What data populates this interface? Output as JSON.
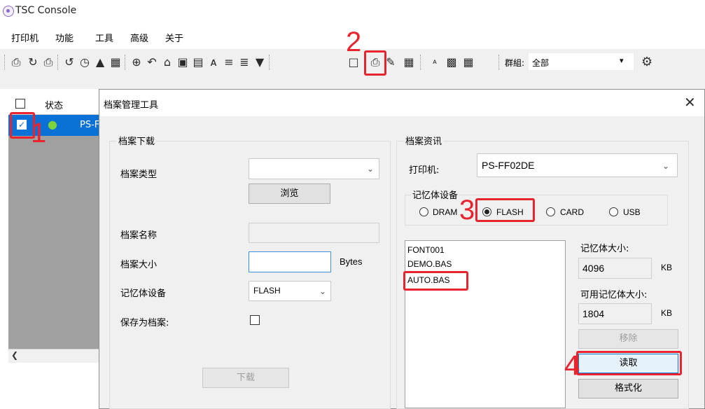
{
  "window": {
    "title": "TSC Console"
  },
  "menu": [
    "打印机",
    "功能",
    "工具",
    "高级",
    "关于"
  ],
  "toolbar": {
    "group_label": "群組:",
    "group_value": "全部"
  },
  "list": {
    "header_status": "状态",
    "row_name": "PS-F"
  },
  "annotations": {
    "n1": "1",
    "n2": "2",
    "n3": "3",
    "n4": "4",
    "accent": "#e8242e"
  },
  "dialog": {
    "title": "档案管理工具",
    "download": {
      "group_title": "档案下载",
      "file_type_label": "档案类型",
      "file_type_value": "",
      "browse_button": "浏览",
      "file_name_label": "档案名称",
      "file_size_label": "档案大小",
      "bytes_unit": "Bytes",
      "memory_label": "记忆体设备",
      "memory_value": "FLASH",
      "save_as_label": "保存为档案:",
      "download_button": "下载"
    },
    "info": {
      "group_title": "档案资讯",
      "printer_label": "打印机:",
      "printer_value": "PS-FF02DE",
      "memory_group_title": "记忆体设备",
      "radios": [
        "DRAM",
        "FLASH",
        "CARD",
        "USB"
      ],
      "selected_radio": "FLASH",
      "files": [
        "FONT001",
        "DEMO.BAS",
        "AUTO.BAS"
      ],
      "memory_size_label": "记忆体大小:",
      "memory_size_value": "4096",
      "kb1": "KB",
      "free_size_label": "可用记忆体大小:",
      "free_size_value": "1804",
      "kb2": "KB",
      "remove_button": "移除",
      "read_button": "读取",
      "format_button": "格式化"
    }
  }
}
